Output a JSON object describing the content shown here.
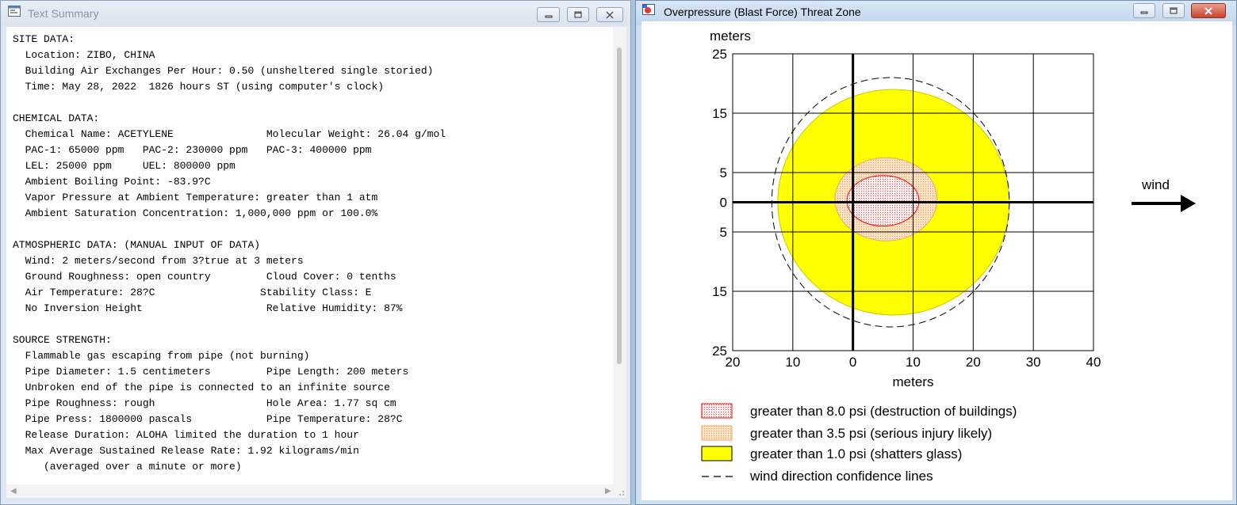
{
  "text_window": {
    "title": "Text Summary",
    "lines": [
      "SITE DATA:",
      "  Location: ZIBO, CHINA",
      "  Building Air Exchanges Per Hour: 0.50 (unsheltered single storied)",
      "  Time: May 28, 2022  1826 hours ST (using computer's clock)",
      "",
      "CHEMICAL DATA:",
      "  Chemical Name: ACETYLENE               Molecular Weight: 26.04 g/mol",
      "  PAC-1: 65000 ppm   PAC-2: 230000 ppm   PAC-3: 400000 ppm",
      "  LEL: 25000 ppm     UEL: 800000 ppm",
      "  Ambient Boiling Point: -83.9?C",
      "  Vapor Pressure at Ambient Temperature: greater than 1 atm",
      "  Ambient Saturation Concentration: 1,000,000 ppm or 100.0%",
      "",
      "ATMOSPHERIC DATA: (MANUAL INPUT OF DATA)",
      "  Wind: 2 meters/second from 3?true at 3 meters",
      "  Ground Roughness: open country         Cloud Cover: 0 tenths",
      "  Air Temperature: 28?C                 Stability Class: E",
      "  No Inversion Height                    Relative Humidity: 87%",
      "",
      "SOURCE STRENGTH:",
      "  Flammable gas escaping from pipe (not burning)",
      "  Pipe Diameter: 1.5 centimeters         Pipe Length: 200 meters",
      "  Unbroken end of the pipe is connected to an infinite source",
      "  Pipe Roughness: rough                  Hole Area: 1.77 sq cm",
      "  Pipe Press: 1800000 pascals            Pipe Temperature: 28?C",
      "  Release Duration: ALOHA limited the duration to 1 hour",
      "  Max Average Sustained Release Rate: 1.92 kilograms/min",
      "     (averaged over a minute or more)"
    ]
  },
  "plot_window": {
    "title": "Overpressure (Blast Force) Threat Zone"
  },
  "chart_data": {
    "type": "threat-zone",
    "x_label": "meters",
    "y_label": "meters",
    "x_ticks": [
      "20",
      "10",
      "0",
      "10",
      "20",
      "30",
      "40"
    ],
    "x_tick_values": [
      -20,
      -10,
      0,
      10,
      20,
      30,
      40
    ],
    "y_ticks": [
      "25",
      "15",
      "5",
      "0",
      "5",
      "15",
      "25"
    ],
    "y_tick_values": [
      25,
      15,
      5,
      0,
      -5,
      -15,
      -25
    ],
    "xlim": [
      -20,
      40
    ],
    "ylim": [
      -25,
      25
    ],
    "wind_label": "wind",
    "zones": [
      {
        "label": "greater than 8.0 psi (destruction of buildings)",
        "color": "#ff0000",
        "fill": "dots-red",
        "x_extent": [
          -1,
          11
        ],
        "y_extent": [
          -4,
          4.5
        ]
      },
      {
        "label": "greater than 3.5 psi (serious injury likely)",
        "color": "#f4a460",
        "fill": "dots-orange",
        "x_extent": [
          -3,
          14
        ],
        "y_extent": [
          -6.5,
          7.5
        ]
      },
      {
        "label": "greater than 1.0 psi (shatters glass)",
        "color": "#ffff00",
        "fill": "solid",
        "x_extent": [
          -12.5,
          26
        ],
        "y_extent": [
          -19,
          19
        ]
      }
    ],
    "confidence_lines": {
      "label": "wind direction confidence lines",
      "x_extent": [
        -13.5,
        26
      ],
      "y_extent": [
        -21,
        21
      ]
    }
  }
}
